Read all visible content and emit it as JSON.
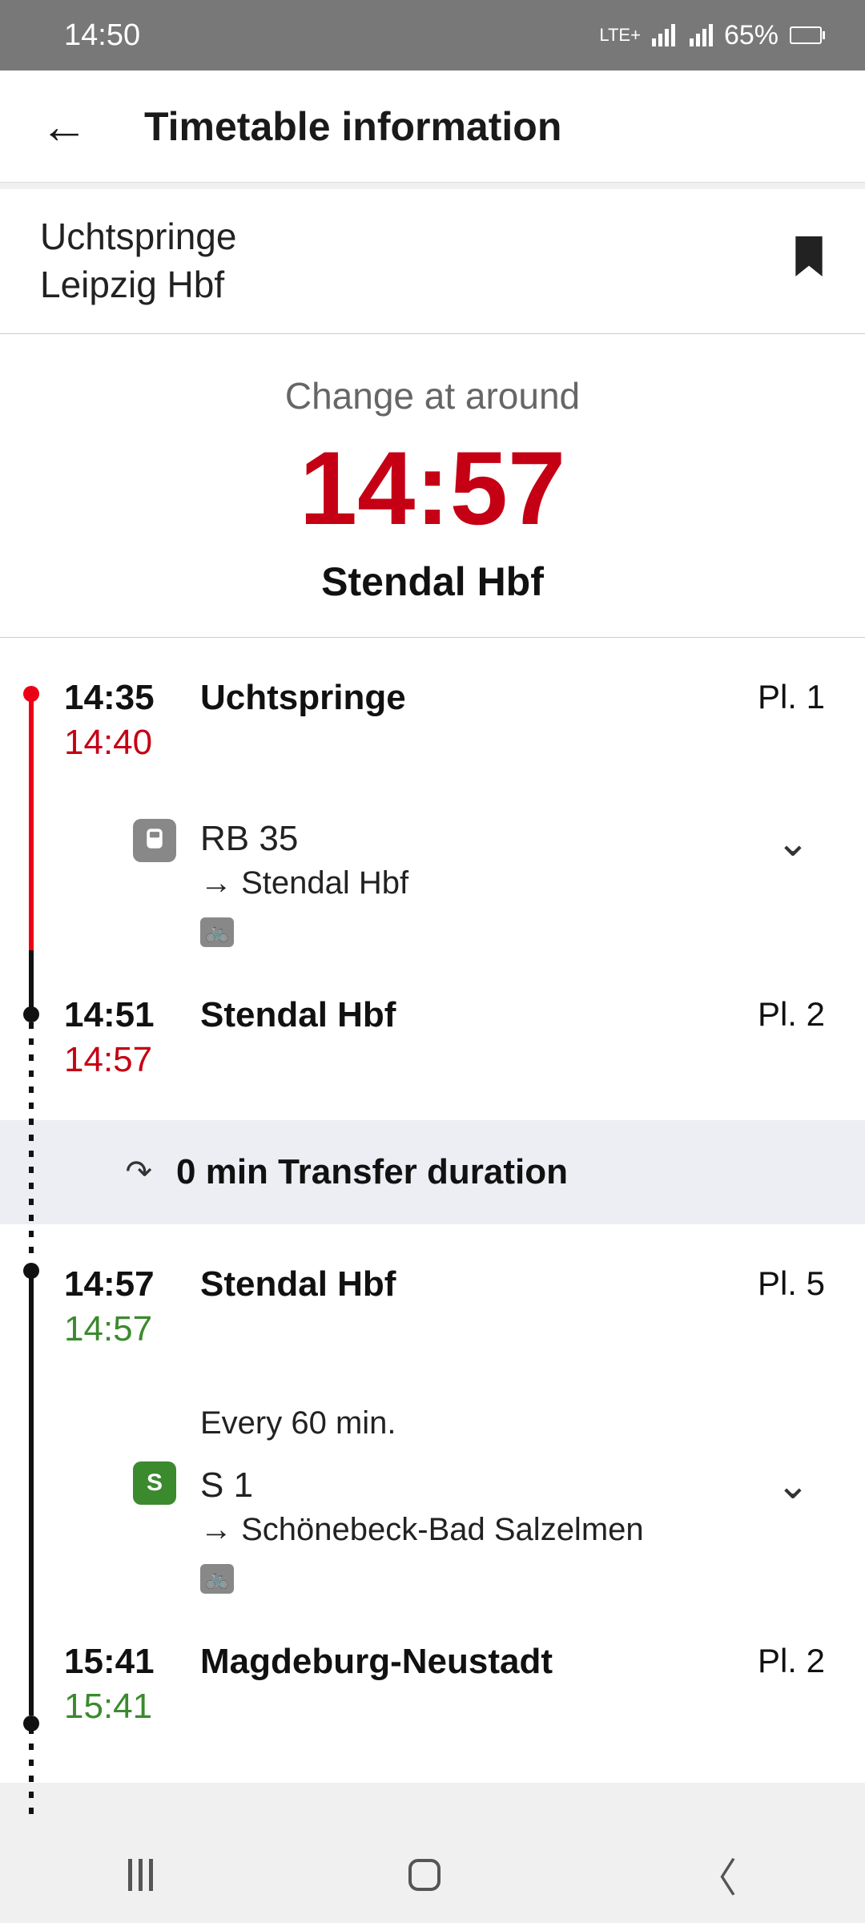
{
  "status": {
    "time": "14:50",
    "network": "LTE+",
    "battery": "65%"
  },
  "header": {
    "title": "Timetable information"
  },
  "route": {
    "from": "Uchtspringe",
    "to": "Leipzig Hbf"
  },
  "changeBanner": {
    "label": "Change at around",
    "time": "14:57",
    "station": "Stendal Hbf"
  },
  "stops": {
    "s0": {
      "sched": "14:35",
      "real": "14:40",
      "realClass": "red",
      "name": "Uchtspringe",
      "platform": "Pl. 1"
    },
    "train0": {
      "iconLabel": "",
      "name": "RB 35",
      "dest": "→  Stendal Hbf"
    },
    "s1": {
      "sched": "14:51",
      "real": "14:57",
      "realClass": "red",
      "name": "Stendal Hbf",
      "platform": "Pl. 2"
    },
    "transfer": {
      "text": "0 min Transfer duration"
    },
    "s2": {
      "sched": "14:57",
      "real": "14:57",
      "realClass": "green",
      "name": "Stendal Hbf",
      "platform": "Pl. 5"
    },
    "train1": {
      "freq": "Every 60 min.",
      "iconLabel": "S",
      "name": "S 1",
      "dest": "→  Schönebeck-Bad Salzelmen"
    },
    "s3": {
      "sched": "15:41",
      "real": "15:41",
      "realClass": "green",
      "name": "Magdeburg-Neustadt",
      "platform": "Pl. 2"
    }
  }
}
